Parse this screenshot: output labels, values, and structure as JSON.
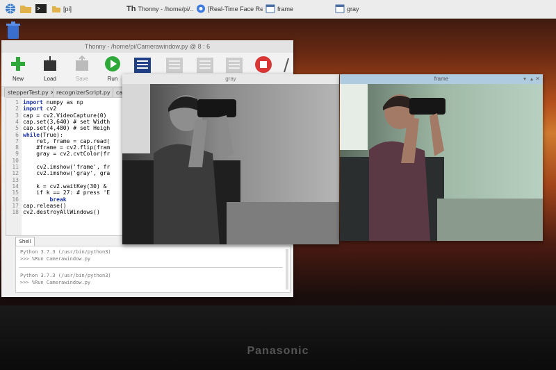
{
  "taskbar": {
    "items": [
      {
        "label": "[pi]"
      },
      {
        "label": "Thonny  -  /home/pi/..."
      },
      {
        "label": "[Real-Time Face Rec..."
      },
      {
        "label": "frame"
      },
      {
        "label": "gray"
      }
    ]
  },
  "thonny": {
    "title": "Thonny  -  /home/pi/Camerawindow.py  @  8 : 6",
    "toolbar": [
      {
        "label": "New",
        "icon": "new-icon"
      },
      {
        "label": "Load",
        "icon": "load-icon"
      },
      {
        "label": "Save",
        "icon": "save-icon"
      },
      {
        "label": "Run",
        "icon": "run-icon"
      }
    ],
    "tabs": [
      "stepperTest.py",
      "recognizerScript.py",
      "cam"
    ],
    "code": [
      {
        "n": "1",
        "kw": "import",
        "rest": " numpy as np"
      },
      {
        "n": "2",
        "kw": "import",
        "rest": " cv2"
      },
      {
        "n": "3",
        "kw": "",
        "rest": "cap = cv2.VideoCapture(0)"
      },
      {
        "n": "4",
        "kw": "",
        "rest": "cap.set(3,640) # set Width"
      },
      {
        "n": "5",
        "kw": "",
        "rest": "cap.set(4,480) # set Heigh"
      },
      {
        "n": "6",
        "kw": "while",
        "rest": "(True):"
      },
      {
        "n": "7",
        "kw": "",
        "rest": "    ret, frame = cap.read("
      },
      {
        "n": "8",
        "kw": "",
        "rest": "    #frame = cv2.flip(fram"
      },
      {
        "n": "9",
        "kw": "",
        "rest": "    gray = cv2.cvtColor(fr"
      },
      {
        "n": "10",
        "kw": "",
        "rest": ""
      },
      {
        "n": "11",
        "kw": "",
        "rest": "    cv2.imshow('frame', fr"
      },
      {
        "n": "12",
        "kw": "",
        "rest": "    cv2.imshow('gray', gra"
      },
      {
        "n": "13",
        "kw": "",
        "rest": ""
      },
      {
        "n": "14",
        "kw": "",
        "rest": "    k = cv2.waitKey(30) & "
      },
      {
        "n": "15",
        "kw": "",
        "rest": "    if k == 27: # press 'E"
      },
      {
        "n": "16",
        "kw": "        break",
        "rest": ""
      },
      {
        "n": "17",
        "kw": "",
        "rest": "cap.release()"
      },
      {
        "n": "18",
        "kw": "",
        "rest": "cv2.destroyAllWindows()"
      }
    ],
    "shell_tab": "Shell",
    "shell": [
      "Python 3.7.3 (/usr/bin/python3)",
      ">>> %Run Camerawindow.py",
      "Python 3.7.3 (/usr/bin/python3)",
      ">>> %Run Camerawindow.py"
    ]
  },
  "gray_window": {
    "title": "gray"
  },
  "frame_window": {
    "title": "frame"
  },
  "monitor": {
    "brand": "Panasonic"
  }
}
